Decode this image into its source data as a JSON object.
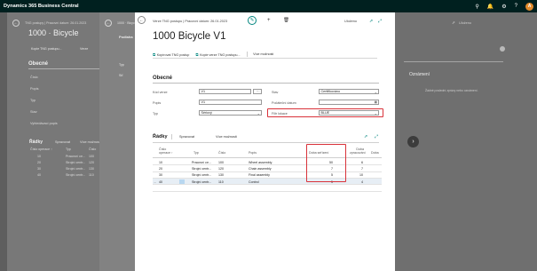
{
  "topbar": {
    "app_title": "Dynamics 365 Business Central",
    "avatar_initial": "A"
  },
  "layer1": {
    "breadcrumb": "TNG postupy | Pracovní datum: 26.01.2023",
    "title": "1000 · Bicycle",
    "action_copy": "Kopie TNG postupu...",
    "action_version": "Verze",
    "section": "Obecné",
    "fields": [
      "Číslo",
      "Popis",
      "Typ",
      "Stav",
      "Vyhledávací popis"
    ],
    "subpage": "Řádky",
    "subtabs": [
      "Spravovat",
      "Více možností"
    ],
    "grid_header": [
      "Číslo operace ↑",
      "Typ",
      "Číslo"
    ],
    "grid_rows": [
      [
        "10",
        "Pracovní ce...",
        "100"
      ],
      [
        "20",
        "Strojní centr...",
        "120"
      ],
      [
        "30",
        "Strojní centr...",
        "130"
      ],
      [
        "40",
        "Strojní centr...",
        "110"
      ]
    ]
  },
  "layer2": {
    "breadcrumb": "1000 · Bicycle",
    "title": "Podlaha",
    "tab_a": "Typ",
    "tab_b": "Síť"
  },
  "layer_right": {
    "saved": "Uloženo",
    "notes_title": "Oznámení",
    "notes_empty": "Žádné poslední zprávy nebo oznámení."
  },
  "card": {
    "breadcrumb": "Verze TNG postupu | Pracovní datum: 26.01.2023",
    "title": "1000 Bicycle V1",
    "saved": "Uloženo",
    "actions": {
      "copy": "Kopírovat TNG postup",
      "copy_version": "Kopie verze TNG postupu...",
      "more": "Více možností"
    },
    "section": "Obecné",
    "fields": {
      "version_code_label": "Kód verze",
      "version_code": "V1",
      "description_label": "Popis",
      "description": "V1",
      "type_label": "Typ",
      "type": "Sériový",
      "status_label": "Stav",
      "status": "Certifikováno",
      "start_date_label": "Počáteční datum",
      "start_date": "",
      "location_filter_label": "Filtr lokace",
      "location_filter": "BLUE"
    },
    "lines": {
      "title": "Řádky",
      "tabs": [
        "Spravovat",
        "Více možností"
      ],
      "columns": [
        "Číslo operace ↑",
        "Typ",
        "Číslo",
        "Popis",
        "Doba seřízení",
        "Doba zpracování",
        "Doba"
      ],
      "rows": [
        {
          "op": "10",
          "type": "Pracovní ce...",
          "no": "100",
          "desc": "Wheel assembly",
          "setup": "50",
          "run": "6"
        },
        {
          "op": "20",
          "type": "Strojní centr...",
          "no": "120",
          "desc": "Chain assembly",
          "setup": "7",
          "run": "7"
        },
        {
          "op": "30",
          "type": "Strojní centr...",
          "no": "130",
          "desc": "Final assembly",
          "setup": "5",
          "run": "10"
        },
        {
          "op": "40",
          "type": "Strojní centr...",
          "no": "110",
          "desc": "Control",
          "setup": "5",
          "run": "4"
        }
      ],
      "selected_marker": "→"
    }
  },
  "colors": {
    "topbar": "#00201f",
    "accent": "#00857e",
    "highlight": "#d9323a"
  }
}
